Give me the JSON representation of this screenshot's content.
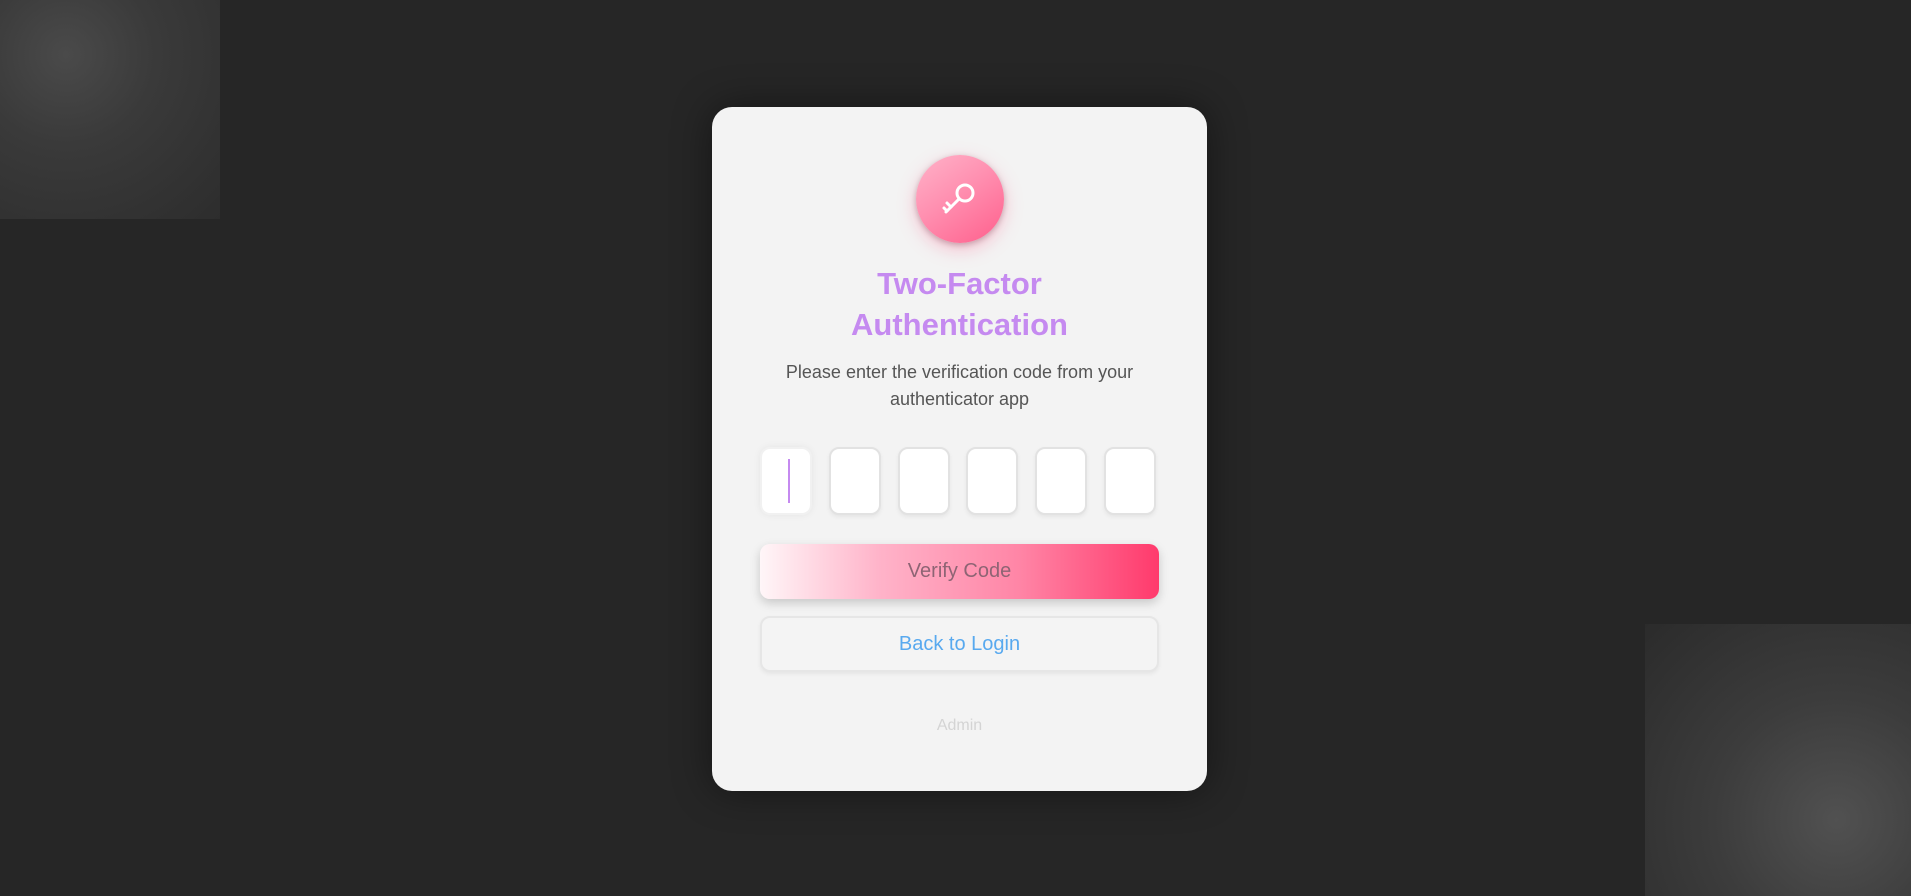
{
  "auth": {
    "title_line1": "Two-Factor",
    "title_line2": "Authentication",
    "subtitle": "Please enter the verification code from your authenticator app",
    "code_digits": [
      "",
      "",
      "",
      "",
      "",
      ""
    ],
    "verify_label": "Verify Code",
    "back_label": "Back to Login",
    "footer": "Admin"
  },
  "icons": {
    "logo": "key-icon"
  },
  "colors": {
    "background": "#262626",
    "card": "#f3f3f3",
    "title": "#c58af0",
    "accent_pink": "#ff3a6c",
    "link_blue": "#58a9ef"
  }
}
